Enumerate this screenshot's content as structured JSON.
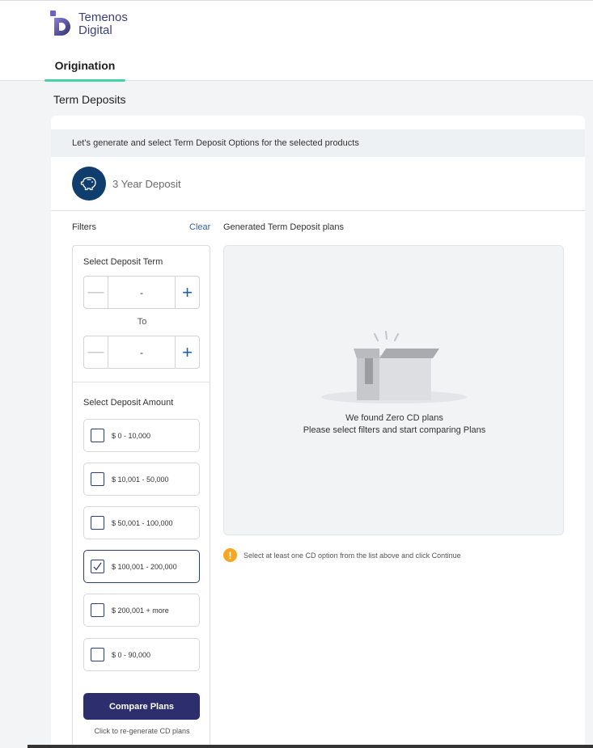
{
  "brand": {
    "line1": "Temenos",
    "line2": "Digital"
  },
  "nav": {
    "active_tab": "Origination"
  },
  "page": {
    "title": "Term Deposits"
  },
  "banner": {
    "text": "Let’s generate and select  Term Deposit Options for the selected products"
  },
  "product": {
    "name": "3 Year Deposit",
    "icon": "piggy-bank-icon"
  },
  "filters": {
    "label": "Filters",
    "clear": "Clear",
    "term": {
      "label": "Select Deposit Term",
      "from_value": "-",
      "to_label": "To",
      "to_value": "-"
    },
    "amount": {
      "label": "Select Deposit Amount",
      "options": [
        {
          "label": "$ 0 - 10,000",
          "checked": false
        },
        {
          "label": "$ 10,001 - 50,000",
          "checked": false
        },
        {
          "label": "$ 50,001 - 100,000",
          "checked": false
        },
        {
          "label": "$ 100,001 - 200,000",
          "checked": true
        },
        {
          "label": "$ 200,001 + more",
          "checked": false
        },
        {
          "label": "$ 0 - 90,000",
          "checked": false
        }
      ]
    },
    "compare_button": "Compare Plans",
    "regenerate_hint": "Click to re-generate CD plans"
  },
  "plans": {
    "label": "Generated Term Deposit plans",
    "empty_line1": "We found Zero CD plans",
    "empty_line2": "Please select filters and start comparing Plans"
  },
  "hint": {
    "text": "Select at least one CD option from the list above and click Continue"
  },
  "colors": {
    "accent": "#46d2a9",
    "primary": "#2d2e6e",
    "link": "#2b66b2",
    "warning": "#f5a623",
    "product_icon_bg": "#0f3d6d"
  }
}
